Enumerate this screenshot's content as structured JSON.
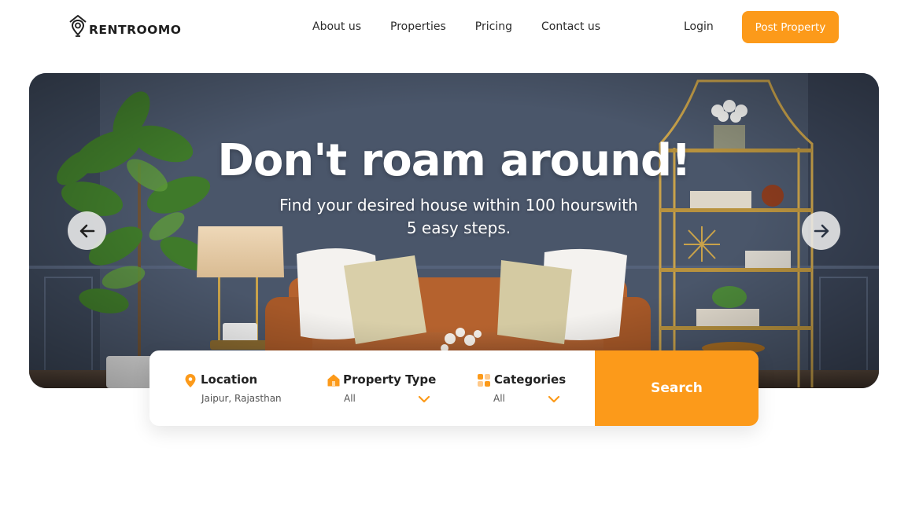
{
  "brand": {
    "name": "RENTROOMO"
  },
  "nav": {
    "items": [
      {
        "label": "About us"
      },
      {
        "label": "Properties"
      },
      {
        "label": "Pricing"
      },
      {
        "label": "Contact us"
      }
    ],
    "login_label": "Login",
    "post_label": "Post Property"
  },
  "hero": {
    "title": "Don't roam around!",
    "subtitle": "Find your desired house within 100 hourswith 5 easy steps."
  },
  "search": {
    "location": {
      "label": "Location",
      "value": "Jaipur, Rajasthan",
      "icon": "location-pin-icon"
    },
    "property_type": {
      "label": "Property Type",
      "value": "All",
      "icon": "house-icon"
    },
    "categories": {
      "label": "Categories",
      "value": "All",
      "icon": "grid-icon"
    },
    "button_label": "Search"
  },
  "colors": {
    "accent": "#fc9a1a",
    "hero_wall": "#465266",
    "text": "#222222"
  }
}
